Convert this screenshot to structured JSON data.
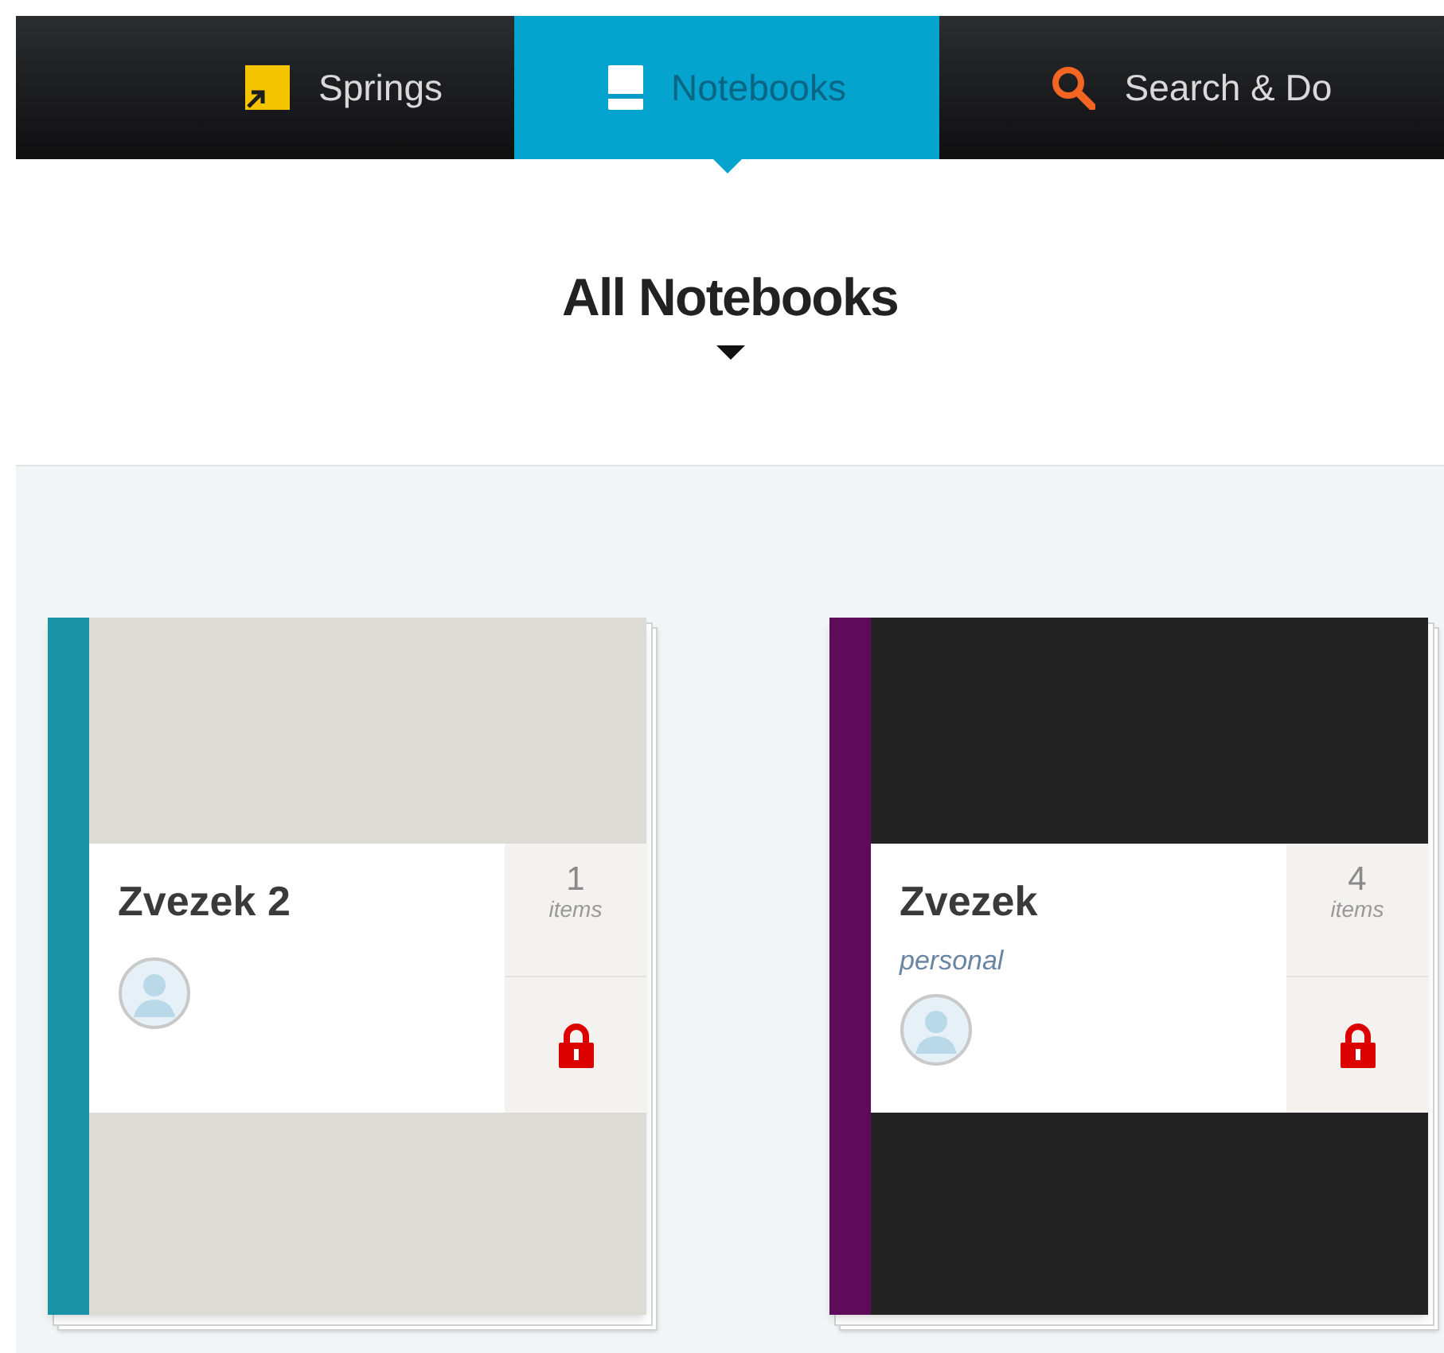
{
  "nav_tabs": [
    {
      "label": "Springs",
      "kind": "springs",
      "selected": false
    },
    {
      "label": "Notebooks",
      "kind": "notebooks",
      "selected": true
    },
    {
      "label": "Search & Do",
      "kind": "search",
      "selected": false
    }
  ],
  "heading": "All Notebooks",
  "notebooks": [
    {
      "name": "Zvezek 2",
      "kind": "light",
      "color": "#1a93a6",
      "count": "1",
      "count_label": "items",
      "locked": true
    },
    {
      "name": "Zvezek",
      "kind": "dark",
      "color": "#5e0b5a",
      "tag": "personal",
      "count": "4",
      "count_label": "items",
      "locked": true
    }
  ]
}
